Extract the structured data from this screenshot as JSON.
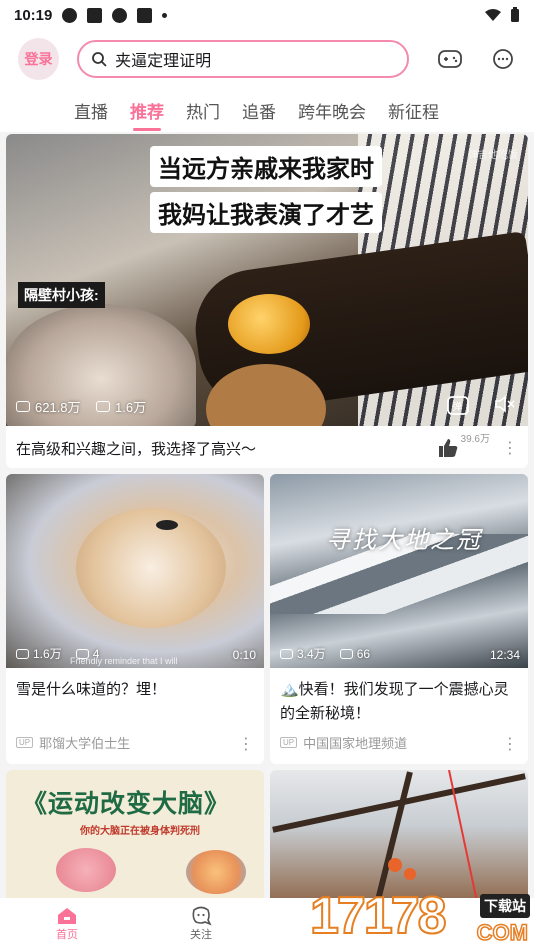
{
  "status_bar": {
    "time": "10:19"
  },
  "header": {
    "login_label": "登录",
    "search_placeholder": "夹逼定理证明",
    "game_icon": "gamepad-icon",
    "message_icon": "message-icon"
  },
  "tabs": [
    {
      "label": "直播",
      "active": false
    },
    {
      "label": "推荐",
      "active": true
    },
    {
      "label": "热门",
      "active": false
    },
    {
      "label": "追番",
      "active": false
    },
    {
      "label": "跨年晚会",
      "active": false
    },
    {
      "label": "新征程",
      "active": false
    }
  ],
  "featured": {
    "caption_line1": "当远方亲戚来我家时",
    "caption_line2": "我妈让我表演了才艺",
    "side_label": "隔壁村小孩:",
    "watermark": "弹吉他吃饭",
    "views": "621.8万",
    "danmaku": "1.6万",
    "title": "在高级和兴趣之间，我选择了高兴～",
    "likes": "39.6万"
  },
  "cards": [
    {
      "views": "1.6万",
      "danmaku": "4",
      "duration": "0:10",
      "subtitle": "Friendly reminder that I will",
      "title": "雪是什么味道的？埋！",
      "uploader": "耶馏大学伯士生"
    },
    {
      "views": "3.4万",
      "danmaku": "66",
      "duration": "12:34",
      "overlay": "寻找大地之冠",
      "title": "🏔️快看！我们发现了一个震撼心灵的全新秘境！",
      "uploader": "中国国家地理频道"
    },
    {
      "overlay": "《运动改变大脑》",
      "overlay_sub": "你的大脑正在被身体判死刑"
    },
    {}
  ],
  "bottom_nav": [
    {
      "label": "首页",
      "active": true
    },
    {
      "label": "关注",
      "active": false
    }
  ],
  "overlay_watermark": {
    "site": "17178",
    "tag": "下载站",
    "domain": "COM"
  }
}
